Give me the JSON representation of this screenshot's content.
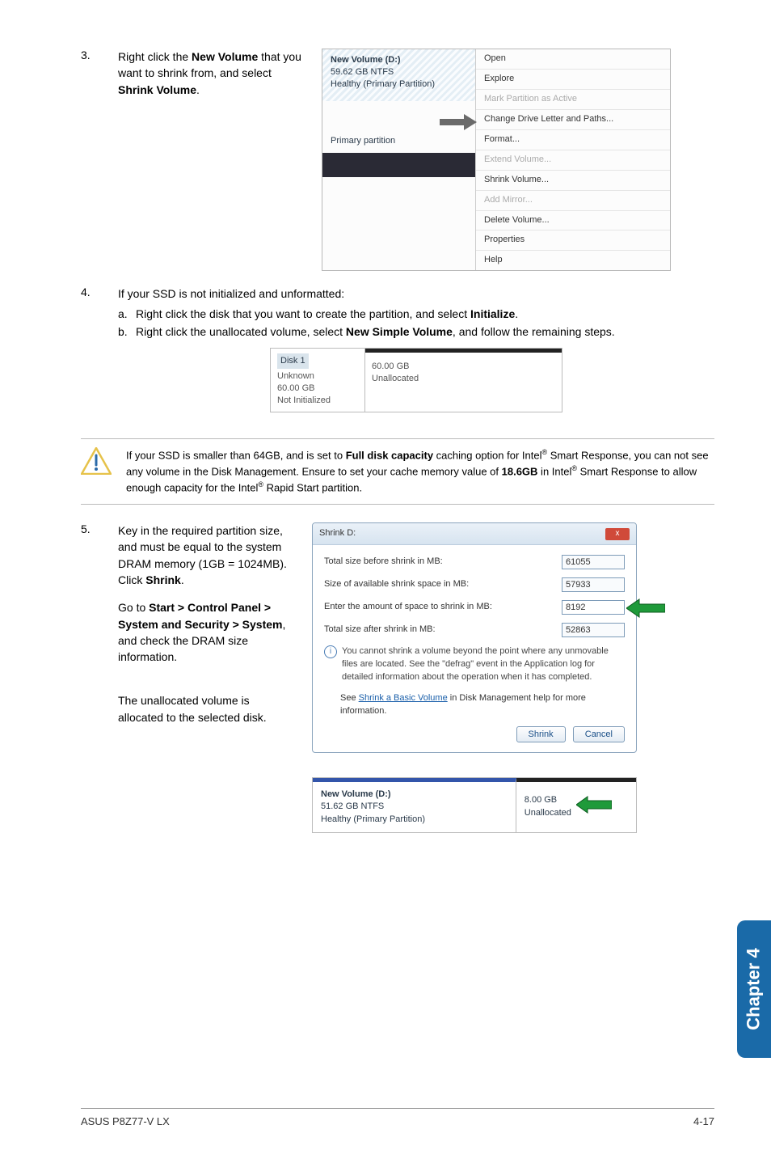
{
  "steps": {
    "s3": {
      "num": "3.",
      "text_prefix": "Right click the ",
      "bold1": "New Volume",
      "text_mid": " that you want to shrink from, and select ",
      "bold2": "Shrink Volume",
      "text_suffix": "."
    },
    "s4": {
      "num": "4.",
      "intro": "If your SSD is not initialized and unformatted:",
      "a_prefix": "Right click the disk that you want to create the partition, and select ",
      "a_bold": "Initialize",
      "a_suffix": ".",
      "b_prefix": "Right click the unallocated volume, select ",
      "b_bold": "New Simple Volume",
      "b_suffix": ", and follow the remaining steps."
    },
    "s5": {
      "num": "5.",
      "p1_prefix": "Key in the required partition size, and must be equal to the system DRAM memory (1GB = 1024MB). Click ",
      "p1_bold": "Shrink",
      "p1_suffix": ".",
      "p2_prefix": "Go to ",
      "p2_bold": "Start > Control Panel > System and Security > System",
      "p2_suffix": ", and check the DRAM size information.",
      "p3": "The unallocated volume is allocated to the selected disk."
    }
  },
  "ctx_menu": {
    "vol_title": "New Volume  (D:)",
    "vol_sub1": "59.62 GB NTFS",
    "vol_sub2": "Healthy (Primary Partition)",
    "primary": "Primary partition",
    "items": {
      "open": "Open",
      "explore": "Explore",
      "mark": "Mark Partition as Active",
      "change": "Change Drive Letter and Paths...",
      "format": "Format...",
      "extend": "Extend Volume...",
      "shrink": "Shrink Volume...",
      "mirror": "Add Mirror...",
      "delete": "Delete Volume...",
      "props": "Properties",
      "help": "Help"
    }
  },
  "disk1": {
    "label": "Disk 1",
    "l1": "Unknown",
    "l2": "60.00 GB",
    "l3": "Not Initialized",
    "r1": "60.00 GB",
    "r2": "Unallocated"
  },
  "note": {
    "t1": "If your SSD is smaller than 64GB, and is set to ",
    "b1": "Full disk capacity",
    "t2": " caching option for Intel",
    "t3": " Smart Response, you can not see any volume in the Disk Management. Ensure to set your cache memory value of ",
    "b2": "18.6GB",
    "t4": " in Intel",
    "t5": " Smart Response to allow enough capacity for the Intel",
    "t6": " Rapid Start partition.",
    "reg": "®"
  },
  "shrink": {
    "title": "Shrink D:",
    "f1_label": "Total size before shrink in MB:",
    "f1_val": "61055",
    "f2_label": "Size of available shrink space in MB:",
    "f2_val": "57933",
    "f3_label": "Enter the amount of space to shrink in MB:",
    "f3_val": "8192",
    "f4_label": "Total size after shrink in MB:",
    "f4_val": "52863",
    "info": "You cannot shrink a volume beyond the point where any unmovable files are located. See the \"defrag\" event in the Application log for detailed information about the operation when it has completed.",
    "link_pre": "See ",
    "link": "Shrink a Basic Volume",
    "link_post": " in Disk Management help for more information.",
    "btn_shrink": "Shrink",
    "btn_cancel": "Cancel"
  },
  "dm": {
    "left_title": "New Volume  (D:)",
    "left_l1": "51.62 GB NTFS",
    "left_l2": "Healthy (Primary Partition)",
    "right_l1": "8.00 GB",
    "right_l2": "Unallocated"
  },
  "chapter": "Chapter 4",
  "footer_left": "ASUS P8Z77-V LX",
  "footer_right": "4-17"
}
